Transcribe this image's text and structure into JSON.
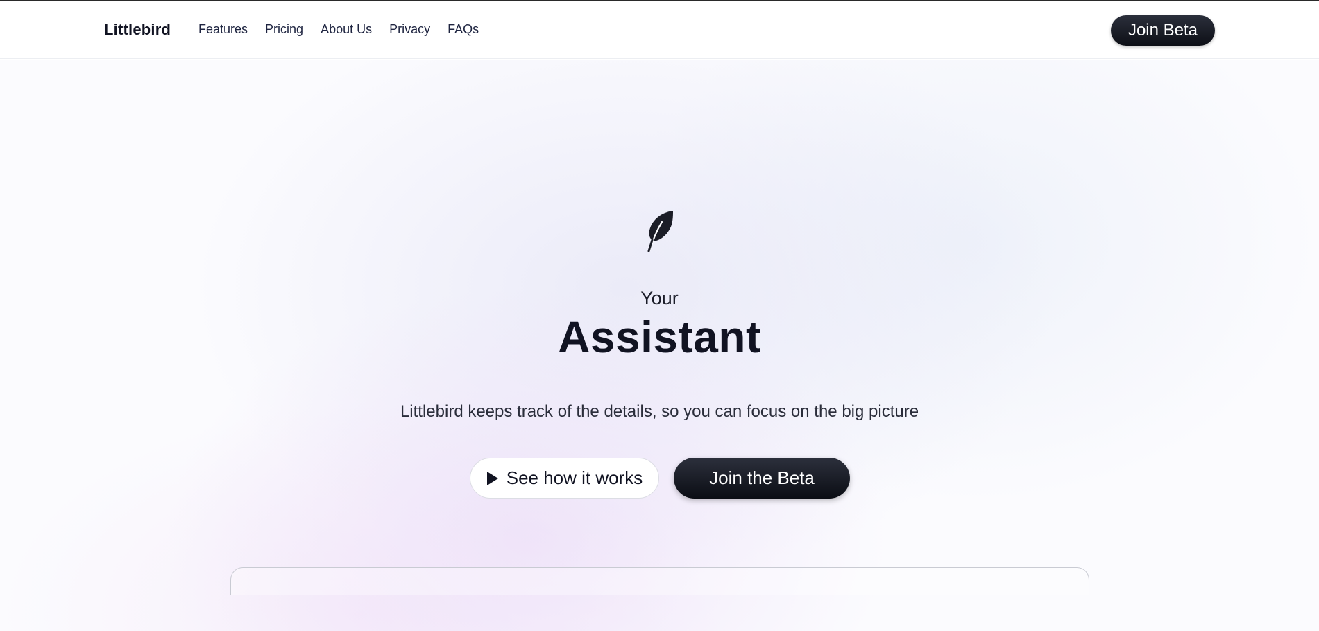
{
  "header": {
    "brand": "Littlebird",
    "nav": [
      {
        "label": "Features"
      },
      {
        "label": "Pricing"
      },
      {
        "label": "About Us"
      },
      {
        "label": "Privacy"
      },
      {
        "label": "FAQs"
      }
    ],
    "cta_label": "Join Beta"
  },
  "hero": {
    "icon": "feather-icon",
    "eyebrow": "Your",
    "headline": "Assistant",
    "subtitle": "Littlebird keeps track of the details, so you can focus on the big picture",
    "secondary_button": {
      "label": "See how it works",
      "icon": "play-icon"
    },
    "primary_button": {
      "label": "Join the Beta"
    }
  },
  "colors": {
    "text": "#111322",
    "button_dark": "#0d0f16",
    "background": "#fbfbfe"
  }
}
